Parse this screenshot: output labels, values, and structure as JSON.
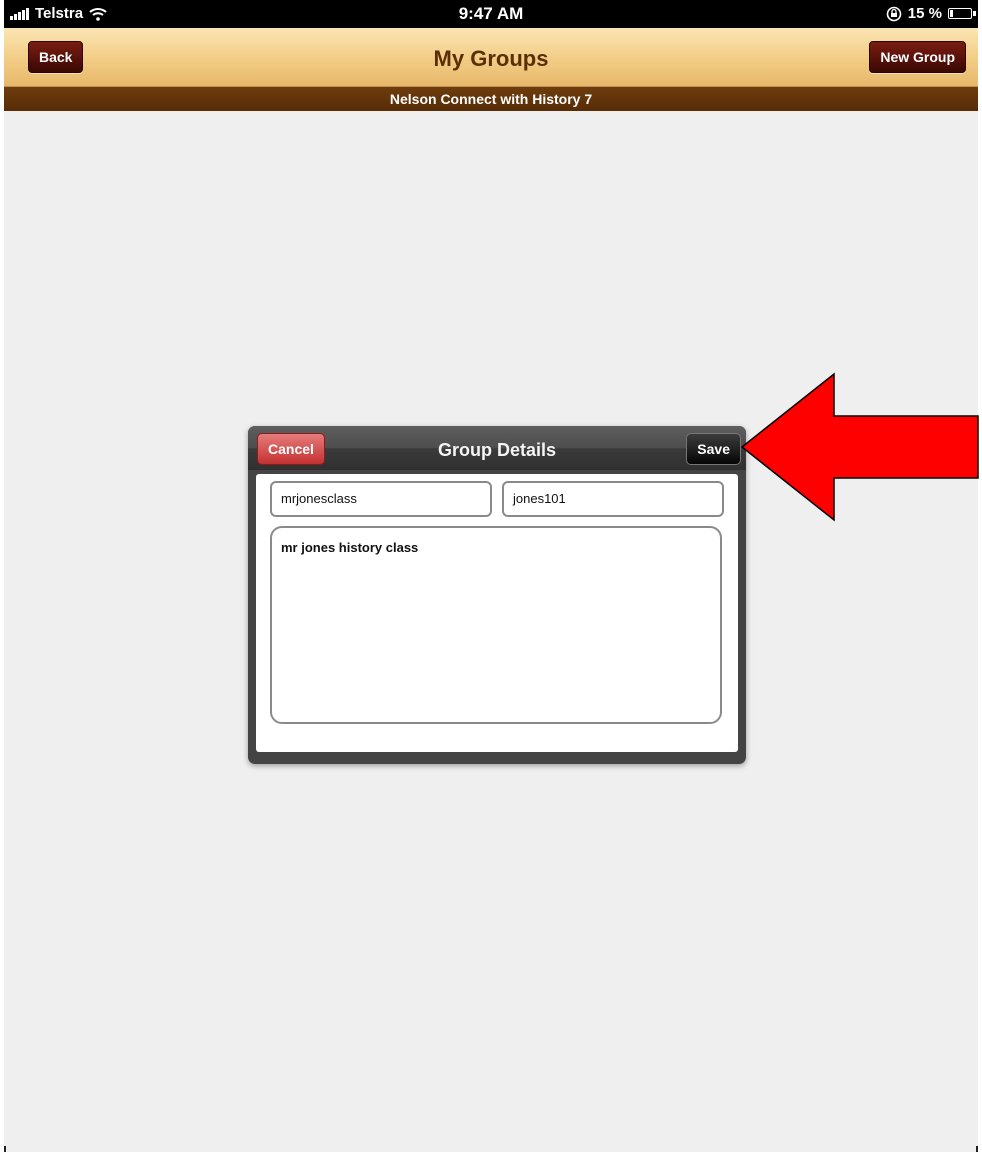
{
  "status_bar": {
    "carrier": "Telstra",
    "time": "9:47 AM",
    "battery": "15 %",
    "battery_level": 0.15
  },
  "nav": {
    "title": "My Groups",
    "back_label": "Back",
    "new_group_label": "New Group",
    "subtitle": "Nelson Connect with History 7"
  },
  "dialog": {
    "title": "Group Details",
    "cancel_label": "Cancel",
    "save_label": "Save",
    "group_name_value": "mrjonesclass",
    "password_value": "jones101",
    "description_value": "mr jones history class"
  },
  "annotation": {
    "arrow_color": "#ff0000",
    "arrow_target": "save-button"
  },
  "colors": {
    "nav_gradient_top": "#fbe6b4",
    "nav_title": "#5a2e06",
    "subbar": "#6e3c0d",
    "cancel": "#c43131"
  }
}
